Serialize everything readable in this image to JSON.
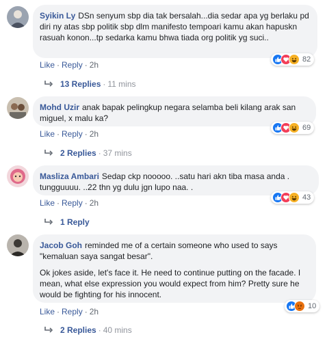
{
  "comments": [
    {
      "author": "Syikin Ly",
      "text": "DSn senyum sbp dia tak bersalah...dia sedar apa yg berlaku pd diri ny atas sbp politik sbp dlm manifesto tempoari kamu akan hapuskn rasuah konon...tp sedarka kamu bhwa tiada org politik yg suci..",
      "like": "Like",
      "reply": "Reply",
      "time": "2h",
      "reaction_count": "82",
      "reactions": [
        "like-icon",
        "love-icon",
        "haha-icon"
      ],
      "replies_label": "13 Replies",
      "replies_time": "11 mins"
    },
    {
      "author": "Mohd Uzir",
      "text": "anak bapak pelingkup negara selamba beli kilang arak san miguel, x malu ka?",
      "like": "Like",
      "reply": "Reply",
      "time": "2h",
      "reaction_count": "69",
      "reactions": [
        "like-icon",
        "love-icon",
        "haha-icon"
      ],
      "replies_label": "2 Replies",
      "replies_time": "37 mins"
    },
    {
      "author": "Masliza Ambari",
      "text": "Sedap ckp nooooo. ..satu hari akn tiba masa anda . tungguuuu. ..22 thn yg dulu jgn lupo naa. .",
      "like": "Like",
      "reply": "Reply",
      "time": "2h",
      "reaction_count": "43",
      "reactions": [
        "like-icon",
        "love-icon",
        "haha-icon"
      ],
      "replies_label": "1 Reply",
      "replies_time": ""
    },
    {
      "author": "Jacob Goh",
      "text": "reminded me of a certain someone who used to says \"kemaluan saya sangat besar\".",
      "text2": "Ok jokes aside, let's face it. He need to continue putting on the facade. I mean, what else expression you would expect from him? Pretty sure he would be fighting for his innocent.",
      "like": "Like",
      "reply": "Reply",
      "time": "2h",
      "reaction_count": "10",
      "reactions": [
        "like-icon",
        "angry-icon"
      ],
      "replies_label": "2 Replies",
      "replies_time": "40 mins"
    }
  ],
  "separator": "·",
  "colors": {
    "link": "#385898",
    "bubble": "#f2f3f5",
    "meta": "#606770",
    "like": "#1877f2",
    "love": "#f33e58",
    "haha": "#f7b125",
    "angry": "#e9710f"
  }
}
